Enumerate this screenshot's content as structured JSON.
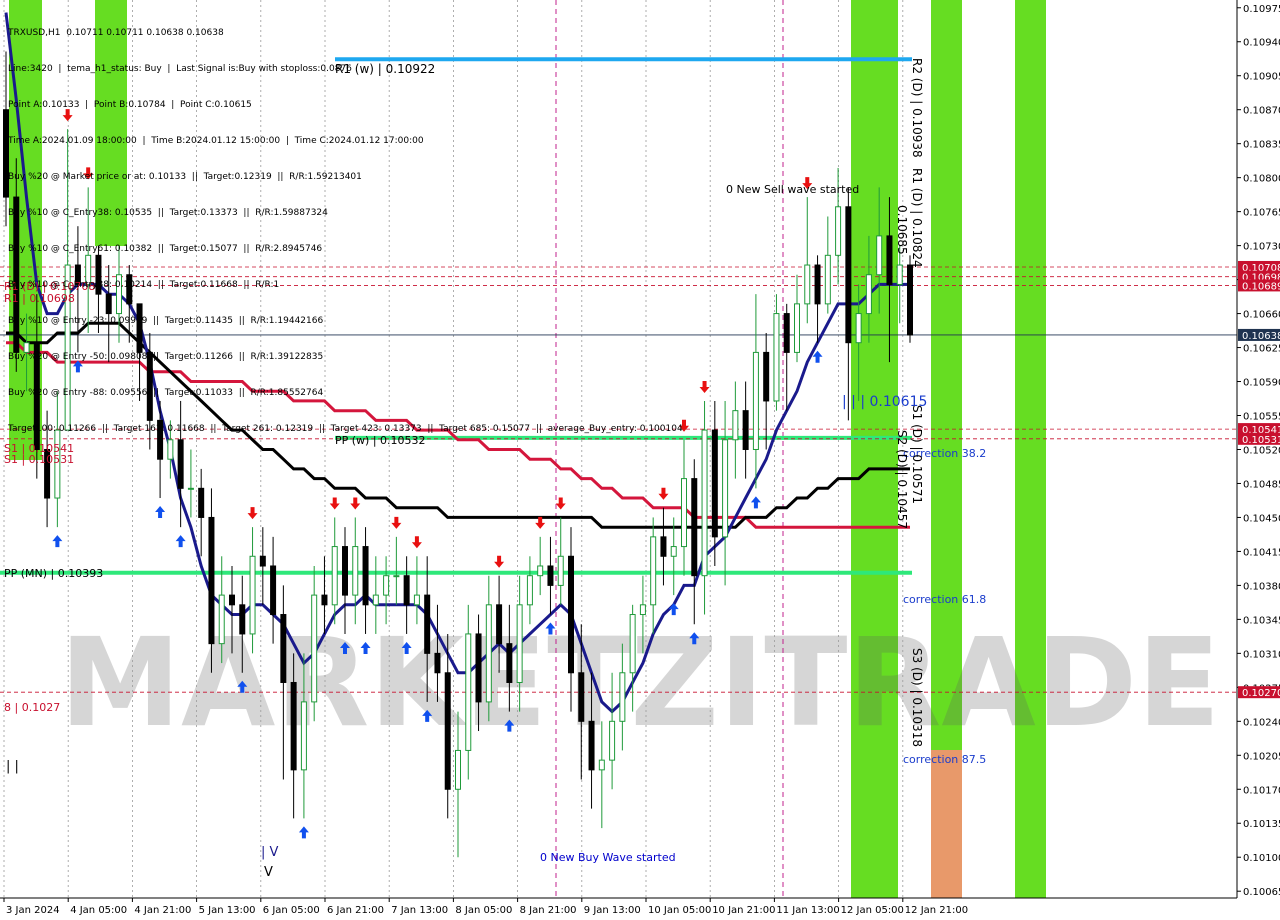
{
  "header": {
    "lines": [
      "TRXUSD,H1  0.10711 0.10711 0.10638 0.10638",
      "Line:3420  |  tema_h1_status: Buy  |  Last Signal is:Buy with stoploss:0.0876",
      "Point A:0.10133  |  Point B:0.10784  |  Point C:0.10615",
      "Time A:2024.01.09 18:00:00  |  Time B:2024.01.12 15:00:00  |  Time C:2024.01.12 17:00:00",
      "Buy %20 @ Market price or at: 0.10133  ||  Target:0.12319  ||  R/R:1.59213401",
      "Buy %10 @ C_Entry38: 0.10535  ||  Target:0.13373  ||  R/R:1.59887324",
      "Buy %10 @ C_Entry61: 0.10382  ||  Target:0.15077  ||  R/R:2.8945746",
      "Buy %10 @ C_Entry88: 0.10214  ||  Target:0.11668  ||  R/R:1",
      "Buy %10 @ Entry -23: 0.09979  ||  Target:0.11435  ||  R/R:1.19442166",
      "Buy %20 @ Entry -50: 0.09808  ||  Target:0.11266  ||  R/R:1.39122835",
      "Buy %20 @ Entry -88: 0.09556  ||  Target:0.11033  ||  R/R:1.85552764",
      "Target100: 0.11266  ||  Target 161: 0.11668  ||  Target 261: 0.12319  ||  Target 423: 0.13373  ||  Target 685: 0.15077  ||  average_Buy_entry: 0.100104"
    ]
  },
  "watermark": "MARKETZITRADE",
  "colors": {
    "bull": "#1f9a3a",
    "bear": "#000000",
    "ema_dark": "#1a1a8c",
    "ema_red": "#d4163c",
    "ma_black": "#000000",
    "green_zone": "#66dd22",
    "orange_zone": "#e8996a",
    "level_cyan": "#1ea8f0",
    "level_green": "#2ee87a",
    "level_red": "#c8102e"
  },
  "chart_data": {
    "type": "candlestick",
    "symbol": "TRXUSD",
    "timeframe": "H1",
    "ylim": [
      0.10058,
      0.10983
    ],
    "yticks": [
      0.10975,
      0.1094,
      0.10905,
      0.1087,
      0.10835,
      0.108,
      0.10765,
      0.1073,
      0.10695,
      0.1066,
      0.10625,
      0.1059,
      0.10555,
      0.1052,
      0.10485,
      0.1045,
      0.10415,
      0.1038,
      0.10345,
      0.1031,
      0.10275,
      0.1024,
      0.10205,
      0.1017,
      0.10135,
      0.101,
      0.10065
    ],
    "xticks": [
      "3 Jan 2024",
      "4 Jan 05:00",
      "4 Jan 21:00",
      "5 Jan 13:00",
      "6 Jan 05:00",
      "6 Jan 21:00",
      "7 Jan 13:00",
      "8 Jan 05:00",
      "8 Jan 21:00",
      "9 Jan 13:00",
      "10 Jan 05:00",
      "10 Jan 21:00",
      "11 Jan 13:00",
      "12 Jan 05:00",
      "12 Jan 21:00"
    ],
    "price_tags": [
      {
        "value": 0.10708,
        "label": "0.10708",
        "color": "#c8102e"
      },
      {
        "value": 0.10698,
        "label": "0.10698",
        "color": "#c8102e"
      },
      {
        "value": 0.10689,
        "label": "0.10689",
        "color": "#c8102e"
      },
      {
        "value": 0.10638,
        "label": "0.10638",
        "color": "#1f3350"
      },
      {
        "value": 0.10541,
        "label": "0.10541",
        "color": "#c8102e"
      },
      {
        "value": 0.10531,
        "label": "0.10531",
        "color": "#c8102e"
      },
      {
        "value": 0.1027,
        "label": "0.10270",
        "color": "#c8102e"
      }
    ],
    "levels": [
      {
        "name": "R1 (w) | 0.10922",
        "value": 0.10922,
        "color": "#1ea8f0"
      },
      {
        "name": "PP (w) | 0.10532",
        "value": 0.10532,
        "color": "#2ee87a"
      },
      {
        "name": "PP (MN) | 0.10393",
        "value": 0.10393,
        "color": "#2ee87a"
      }
    ],
    "left_labels": [
      {
        "text": "R1 (D) | 0.10708",
        "value": 0.10708
      },
      {
        "text": "R1 | 0.10698",
        "value": 0.10698
      },
      {
        "text": "S1 | 0.10541",
        "value": 0.10541
      },
      {
        "text": "S1 | 0.10531",
        "value": 0.10531
      },
      {
        "text": "8 | 0.1027",
        "value": 0.1027
      }
    ],
    "annotations": [
      {
        "text": "0 New Sell wave started",
        "color": "#000000"
      },
      {
        "text": "0 New Buy Wave started",
        "color": "#0000cc"
      },
      {
        "text": "| | | 0.10615",
        "color": "#1a3ccc"
      },
      {
        "text": "correction 38.2",
        "color": "#1a3ccc"
      },
      {
        "text": "correction 61.8",
        "color": "#1a3ccc"
      },
      {
        "text": "correction 87.5",
        "color": "#1a3ccc"
      },
      {
        "text": "| V",
        "color": "#1a1a8c"
      },
      {
        "text": "V",
        "color": "#000000"
      },
      {
        "text": "| |",
        "color": "#000000"
      }
    ],
    "vertical_labels": [
      "R2 (D) | 0.10938",
      "R1 (D) | 0.10824",
      "S1 (D) | 0.10571",
      "S2 (D) | 0.10457",
      "S3 (D) | 0.10318",
      "0.10685"
    ],
    "series": [
      {
        "name": "open",
        "values": [
          0.1087,
          0.1078,
          0.1062,
          0.1063,
          0.1052,
          0.1047,
          0.1054,
          0.1071,
          0.1069,
          0.1072,
          0.1068,
          0.1066,
          0.107,
          0.1067,
          0.1062,
          0.1055,
          0.1051,
          0.1053,
          0.1048,
          0.1048,
          0.1045,
          0.1032,
          0.1037,
          0.1036,
          0.1033,
          0.1041,
          0.104,
          0.1035,
          0.1028,
          0.1019,
          0.1026,
          0.1037,
          0.1036,
          0.1042,
          0.1037,
          0.1042,
          0.1036,
          0.1037,
          0.1039,
          0.1039,
          0.1036,
          0.1037,
          0.1031,
          0.1029,
          0.1017,
          0.1021,
          0.1033,
          0.1026,
          0.1036,
          0.1032,
          0.1028,
          0.1036,
          0.1039,
          0.104,
          0.1038,
          0.1041,
          0.1029,
          0.1024,
          0.1019,
          0.102,
          0.1024,
          0.1029,
          0.1035,
          0.1036,
          0.1043,
          0.1041,
          0.1042,
          0.1049,
          0.1039,
          0.1054,
          0.1043,
          0.1053,
          0.1056,
          0.1052,
          0.1062,
          0.1057,
          0.1066,
          0.1062,
          0.1067,
          0.1071,
          0.1067,
          0.1072,
          0.1077,
          0.1063,
          0.1066,
          0.107,
          0.1074,
          0.1069,
          0.1071
        ]
      },
      {
        "name": "close",
        "values": [
          0.1078,
          0.1062,
          0.1063,
          0.1052,
          0.1047,
          0.1054,
          0.1071,
          0.1069,
          0.1072,
          0.1068,
          0.1066,
          0.107,
          0.1067,
          0.1062,
          0.1055,
          0.1051,
          0.1053,
          0.1048,
          0.1048,
          0.1045,
          0.1032,
          0.1037,
          0.1036,
          0.1033,
          0.1041,
          0.104,
          0.1035,
          0.1028,
          0.1019,
          0.1026,
          0.1037,
          0.1036,
          0.1042,
          0.1037,
          0.1042,
          0.1036,
          0.1037,
          0.1039,
          0.1039,
          0.1036,
          0.1037,
          0.1031,
          0.1029,
          0.1017,
          0.1021,
          0.1033,
          0.1026,
          0.1036,
          0.1032,
          0.1028,
          0.1036,
          0.1039,
          0.104,
          0.1038,
          0.1041,
          0.1029,
          0.1024,
          0.1019,
          0.102,
          0.1024,
          0.1029,
          0.1035,
          0.1036,
          0.1043,
          0.1041,
          0.1042,
          0.1049,
          0.1039,
          0.1054,
          0.1043,
          0.1053,
          0.1056,
          0.1052,
          0.1062,
          0.1057,
          0.1066,
          0.1062,
          0.1067,
          0.1071,
          0.1067,
          0.1072,
          0.1077,
          0.1063,
          0.1066,
          0.107,
          0.1074,
          0.1069,
          0.1071,
          0.10638
        ]
      },
      {
        "name": "high",
        "values": [
          0.1093,
          0.1082,
          0.1066,
          0.1068,
          0.1056,
          0.1058,
          0.1085,
          0.1075,
          0.1079,
          0.1073,
          0.1071,
          0.1073,
          0.1071,
          0.1067,
          0.1064,
          0.1057,
          0.1055,
          0.1057,
          0.1052,
          0.105,
          0.1048,
          0.1041,
          0.104,
          0.1039,
          0.1044,
          0.1044,
          0.1043,
          0.1038,
          0.1031,
          0.1031,
          0.104,
          0.1041,
          0.1045,
          0.1044,
          0.1045,
          0.1044,
          0.1041,
          0.1041,
          0.1043,
          0.1041,
          0.1041,
          0.1041,
          0.1036,
          0.1033,
          0.1025,
          0.1036,
          0.1035,
          0.1039,
          0.1039,
          0.1036,
          0.1039,
          0.1041,
          0.1043,
          0.1043,
          0.1045,
          0.1044,
          0.1034,
          0.1029,
          0.1024,
          0.1029,
          0.1032,
          0.1036,
          0.1039,
          0.1045,
          0.1046,
          0.1045,
          0.1053,
          0.1051,
          0.1057,
          0.1057,
          0.1057,
          0.1059,
          0.1059,
          0.1068,
          0.1064,
          0.1068,
          0.1067,
          0.107,
          0.1078,
          0.1072,
          0.1076,
          0.1081,
          0.1079,
          0.1069,
          0.1074,
          0.1079,
          0.1078,
          0.1073,
          0.1072
        ]
      },
      {
        "name": "low",
        "values": [
          0.1075,
          0.106,
          0.1058,
          0.1049,
          0.1044,
          0.1044,
          0.1067,
          0.1062,
          0.1064,
          0.1064,
          0.1061,
          0.1063,
          0.1063,
          0.1057,
          0.1052,
          0.1047,
          0.1049,
          0.1044,
          0.1045,
          0.1041,
          0.1029,
          0.103,
          0.1031,
          0.1029,
          0.1031,
          0.1036,
          0.1032,
          0.1018,
          0.1014,
          0.1014,
          0.1024,
          0.1033,
          0.1034,
          0.1033,
          0.1034,
          0.1033,
          0.1033,
          0.1034,
          0.1036,
          0.1033,
          0.1034,
          0.1026,
          0.1026,
          0.1014,
          0.101,
          0.1018,
          0.1023,
          0.1024,
          0.1029,
          0.1025,
          0.1025,
          0.1034,
          0.1037,
          0.1035,
          0.1036,
          0.1025,
          0.1018,
          0.1015,
          0.1013,
          0.1017,
          0.1021,
          0.1025,
          0.1031,
          0.1033,
          0.1038,
          0.1037,
          0.1039,
          0.1034,
          0.1035,
          0.104,
          0.1038,
          0.1049,
          0.1049,
          0.1048,
          0.1052,
          0.1056,
          0.1056,
          0.1061,
          0.1065,
          0.1063,
          0.1066,
          0.1069,
          0.1055,
          0.1057,
          0.1063,
          0.1066,
          0.1061,
          0.1065,
          0.1063
        ]
      },
      {
        "name": "ema_fast",
        "values": [
          0.1097,
          0.1088,
          0.1078,
          0.1069,
          0.1066,
          0.1066,
          0.1068,
          0.1069,
          0.1069,
          0.1069,
          0.1068,
          0.1068,
          0.1067,
          0.1065,
          0.1061,
          0.1056,
          0.1052,
          0.1047,
          0.1044,
          0.104,
          0.1037,
          0.1036,
          0.1035,
          0.1035,
          0.1036,
          0.1036,
          0.1035,
          0.1034,
          0.1032,
          0.103,
          0.1031,
          0.1033,
          0.1035,
          0.1036,
          0.1036,
          0.1037,
          0.1036,
          0.1036,
          0.1036,
          0.1036,
          0.1036,
          0.1035,
          0.1033,
          0.1031,
          0.1029,
          0.1029,
          0.103,
          0.1031,
          0.1032,
          0.1031,
          0.1032,
          0.1033,
          0.1034,
          0.1035,
          0.1036,
          0.1035,
          0.1032,
          0.1029,
          0.1026,
          0.1025,
          0.1026,
          0.1028,
          0.103,
          0.1033,
          0.1035,
          0.1036,
          0.1038,
          0.1038,
          0.1041,
          0.1042,
          0.1043,
          0.1045,
          0.1047,
          0.1049,
          0.1051,
          0.1054,
          0.1056,
          0.1058,
          0.1061,
          0.1063,
          0.1065,
          0.1067,
          0.1067,
          0.1067,
          0.1068,
          0.1069,
          0.1069,
          0.1069,
          0.1069
        ]
      },
      {
        "name": "ma_black",
        "values": [
          0.1064,
          0.1064,
          0.1063,
          0.1063,
          0.1063,
          0.1064,
          0.1064,
          0.1064,
          0.1065,
          0.1065,
          0.1065,
          0.1065,
          0.1064,
          0.1063,
          0.1062,
          0.1061,
          0.106,
          0.1059,
          0.1058,
          0.1057,
          0.1056,
          0.1055,
          0.1054,
          0.1054,
          0.1053,
          0.1052,
          0.1052,
          0.1051,
          0.105,
          0.105,
          0.1049,
          0.1049,
          0.1048,
          0.1048,
          0.1048,
          0.1047,
          0.1047,
          0.1047,
          0.1046,
          0.1046,
          0.1046,
          0.1046,
          0.1046,
          0.1045,
          0.1045,
          0.1045,
          0.1045,
          0.1045,
          0.1045,
          0.1045,
          0.1045,
          0.1045,
          0.1045,
          0.1045,
          0.1045,
          0.1045,
          0.1045,
          0.1045,
          0.1044,
          0.1044,
          0.1044,
          0.1044,
          0.1044,
          0.1044,
          0.1044,
          0.1044,
          0.1044,
          0.1044,
          0.1044,
          0.1044,
          0.1044,
          0.1044,
          0.1045,
          0.1045,
          0.1045,
          0.1046,
          0.1046,
          0.1047,
          0.1047,
          0.1048,
          0.1048,
          0.1049,
          0.1049,
          0.1049,
          0.105,
          0.105,
          0.105,
          0.105,
          0.105
        ]
      },
      {
        "name": "ema_red",
        "values": [
          0.1063,
          0.1063,
          0.1062,
          0.1062,
          0.1062,
          0.1061,
          0.1061,
          0.1061,
          0.1061,
          0.1061,
          0.1061,
          0.1061,
          0.1061,
          0.1061,
          0.106,
          0.106,
          0.106,
          0.106,
          0.1059,
          0.1059,
          0.1059,
          0.1059,
          0.1059,
          0.1059,
          0.1058,
          0.1058,
          0.1058,
          0.1058,
          0.1057,
          0.1057,
          0.1057,
          0.1057,
          0.1056,
          0.1056,
          0.1056,
          0.1056,
          0.1055,
          0.1055,
          0.1055,
          0.1055,
          0.1054,
          0.1054,
          0.1054,
          0.1054,
          0.1053,
          0.1053,
          0.1053,
          0.1052,
          0.1052,
          0.1052,
          0.1052,
          0.1051,
          0.1051,
          0.1051,
          0.105,
          0.105,
          0.1049,
          0.1049,
          0.1048,
          0.1048,
          0.1047,
          0.1047,
          0.1047,
          0.1046,
          0.1046,
          0.1046,
          0.1046,
          0.1045,
          0.1045,
          0.1045,
          0.1045,
          0.1045,
          0.1045,
          0.1044,
          0.1044,
          0.1044,
          0.1044,
          0.1044,
          0.1044,
          0.1044,
          0.1044,
          0.1044,
          0.1044,
          0.1044,
          0.1044,
          0.1044,
          0.1044,
          0.1044,
          0.1044
        ]
      }
    ]
  }
}
